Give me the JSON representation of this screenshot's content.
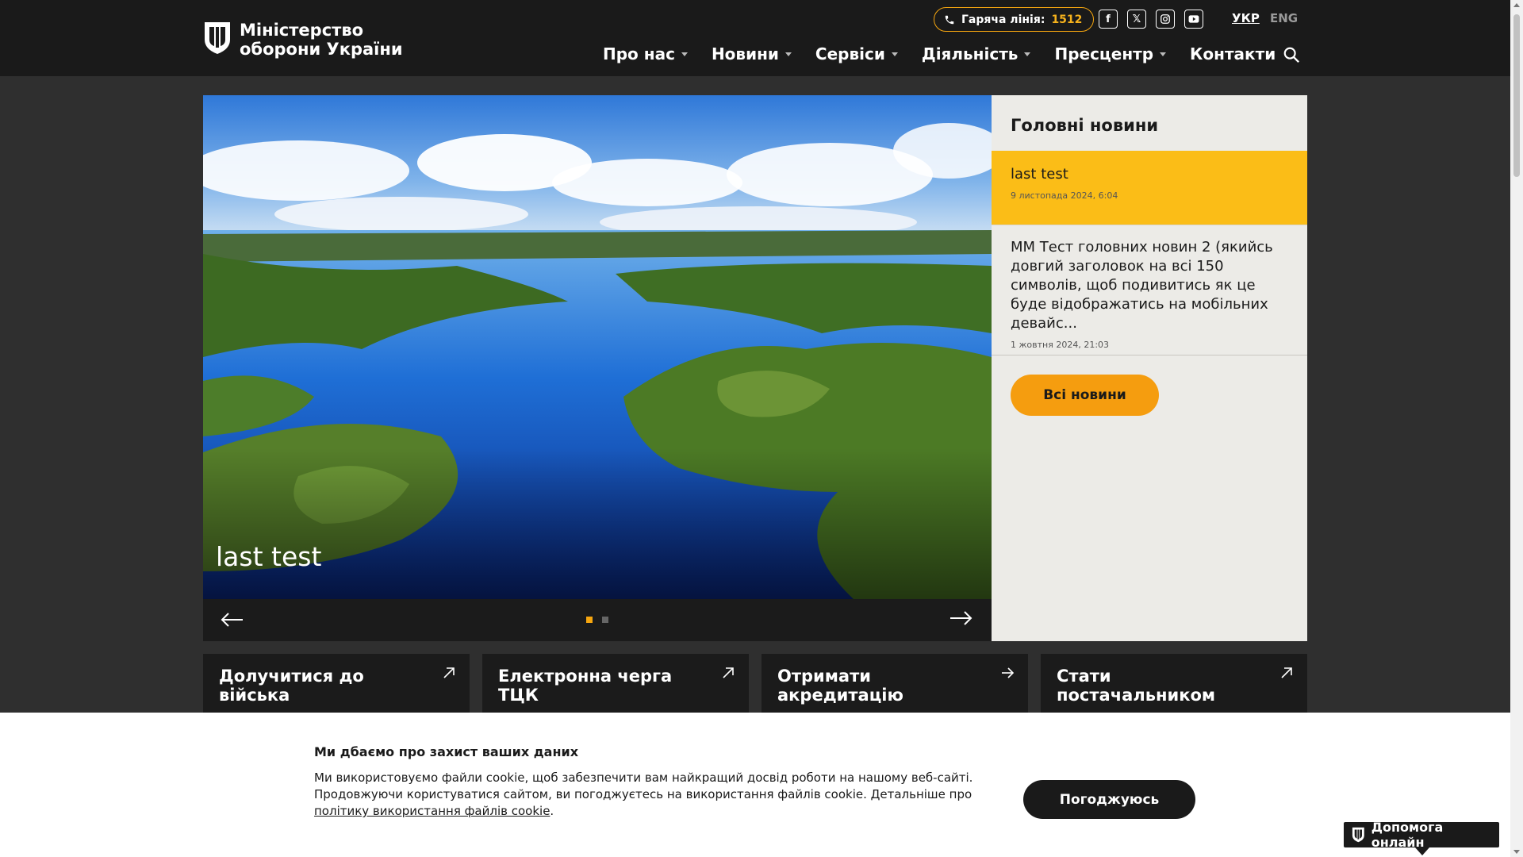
{
  "header": {
    "logo_line1": "Міністерство",
    "logo_line2": "оборони України",
    "hotline_label": "Гаряча лінія:",
    "hotline_number": "1512",
    "socials": [
      "facebook-icon",
      "x-twitter-icon",
      "instagram-icon",
      "youtube-icon"
    ],
    "lang_ukr": "УКР",
    "lang_eng": "ENG",
    "nav": [
      {
        "label": "Про нас",
        "dropdown": true
      },
      {
        "label": "Новини",
        "dropdown": true
      },
      {
        "label": "Сервіси",
        "dropdown": true
      },
      {
        "label": "Діяльність",
        "dropdown": true
      },
      {
        "label": "Пресцентр",
        "dropdown": true
      },
      {
        "label": "Контакти",
        "dropdown": false
      }
    ]
  },
  "slider": {
    "title": "last test",
    "dots": 2,
    "active_dot": 1
  },
  "news": {
    "heading": "Головні новини",
    "items": [
      {
        "title": "last test",
        "date": "9 листопада 2024, 6:04"
      },
      {
        "title": "ММ Тест головних новин 2 (якийсь довгий заголовок на всі 150 символів, щоб подивитись як це буде відображатись на мобільних девайс...",
        "date": "1 жовтня 2024, 21:03"
      }
    ],
    "all_news": "Всі новини"
  },
  "cards": [
    {
      "title": "Долучитися до війська"
    },
    {
      "title": "Електронна черга ТЦК"
    },
    {
      "title": "Отримати акредитацію"
    },
    {
      "title": "Стати постачальником"
    }
  ],
  "cookie": {
    "title": "Ми дбаємо про захист ваших даних",
    "text": "Ми використовуємо файли cookie, щоб забезпечити вам найкращий досвід роботи на нашому веб-сайті. Продовжуючи користуватися сайтом, ви погоджуєтесь на використання файлів cookie. Детальніше про",
    "link": "політику використання файлів cookie",
    "agree": "Погоджуюсь"
  },
  "help": {
    "label": "Допомога онлайн"
  },
  "colors": {
    "accent": "#f6a60f",
    "news_highlight": "#fbbd17",
    "header_bg": "#1a1a1a"
  }
}
